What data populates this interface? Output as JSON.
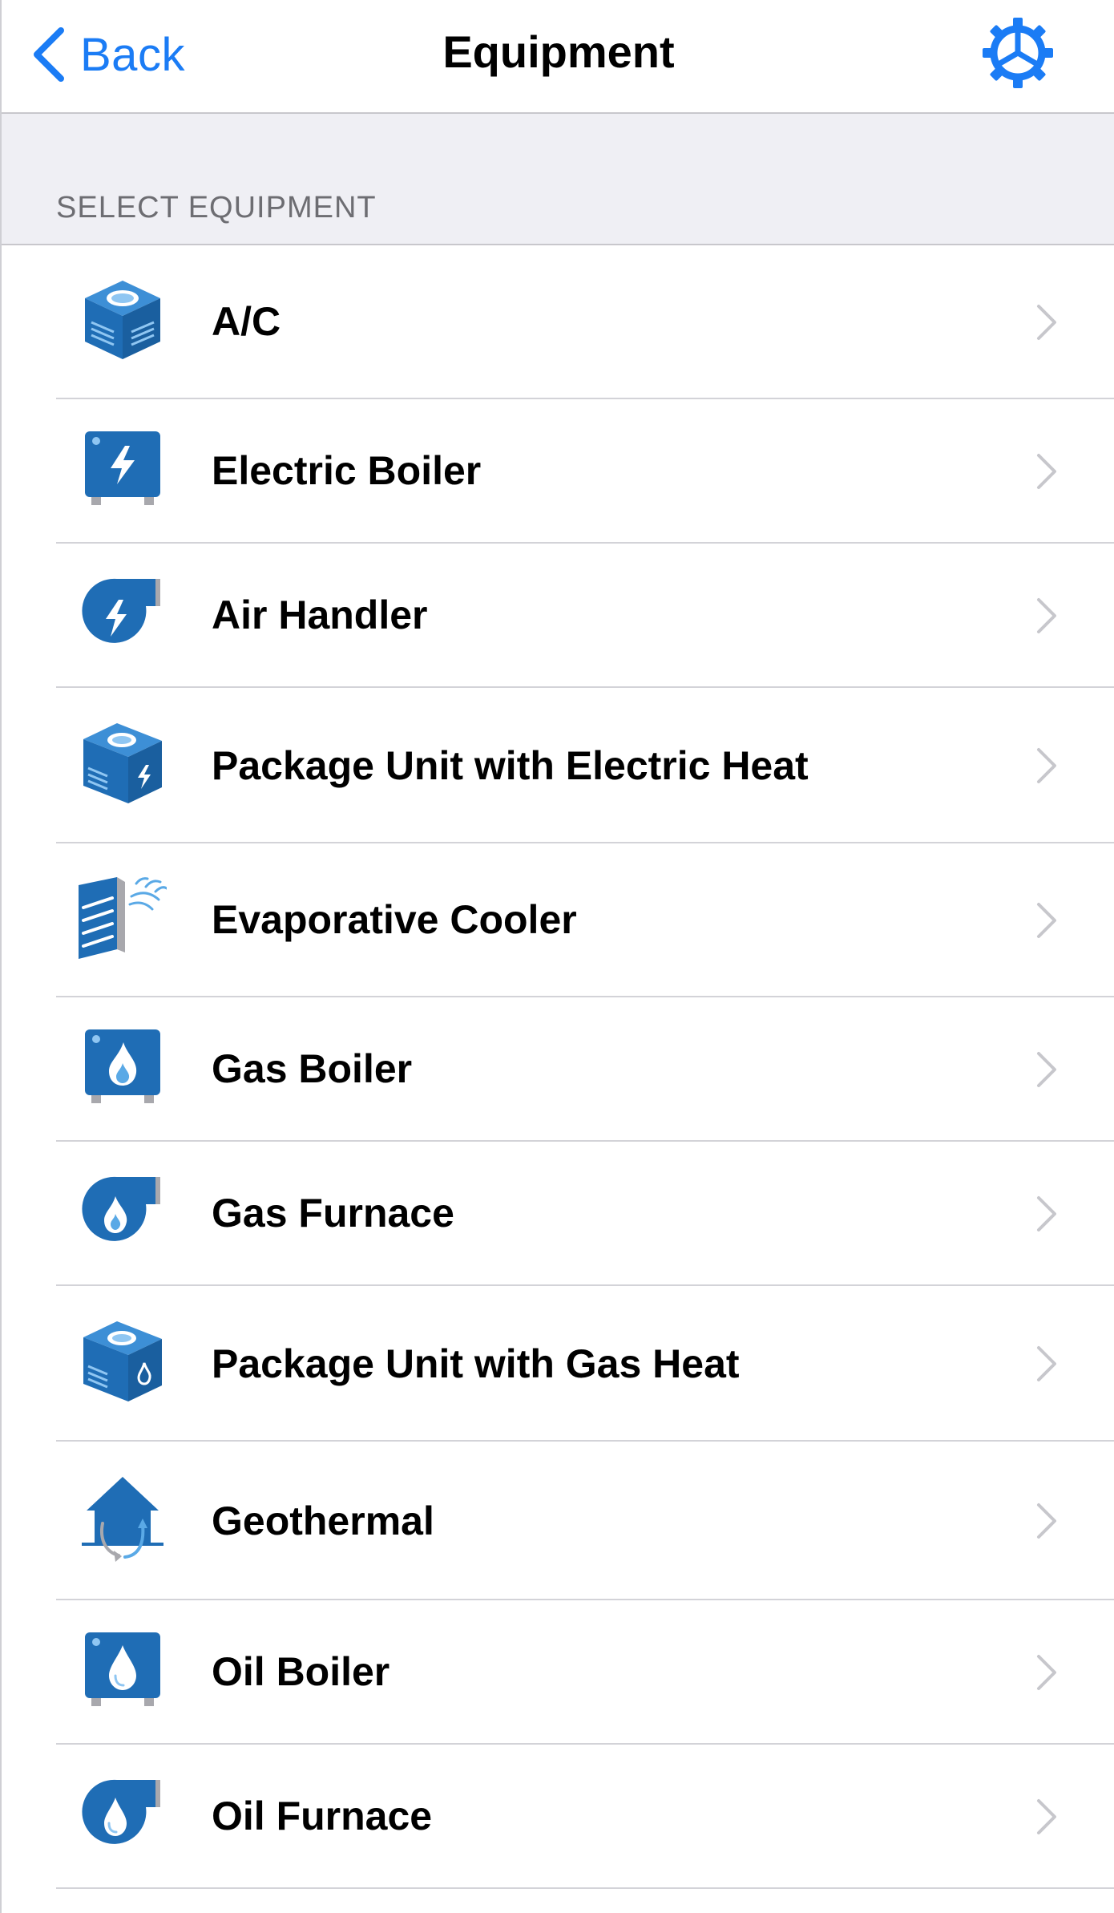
{
  "nav": {
    "back_label": "Back",
    "title": "Equipment",
    "accent_color": "#1b7cf5"
  },
  "section": {
    "header": "SELECT EQUIPMENT"
  },
  "items": [
    {
      "label": "A/C",
      "icon": "ac-unit-icon"
    },
    {
      "label": "Electric Boiler",
      "icon": "electric-boiler-icon"
    },
    {
      "label": "Air Handler",
      "icon": "air-handler-icon"
    },
    {
      "label": "Package Unit with Electric Heat",
      "icon": "package-unit-electric-icon"
    },
    {
      "label": "Evaporative Cooler",
      "icon": "evaporative-cooler-icon"
    },
    {
      "label": "Gas Boiler",
      "icon": "gas-boiler-icon"
    },
    {
      "label": "Gas Furnace",
      "icon": "gas-furnace-icon"
    },
    {
      "label": "Package Unit with Gas Heat",
      "icon": "package-unit-gas-icon"
    },
    {
      "label": "Geothermal",
      "icon": "geothermal-icon"
    },
    {
      "label": "Oil Boiler",
      "icon": "oil-boiler-icon"
    },
    {
      "label": "Oil Furnace",
      "icon": "oil-furnace-icon"
    }
  ],
  "colors": {
    "icon_blue": "#1f6db5",
    "icon_light": "#5aa9e6",
    "chevron": "#c7c7cc",
    "separator": "#d3d3d8",
    "section_bg": "#efeff4"
  }
}
